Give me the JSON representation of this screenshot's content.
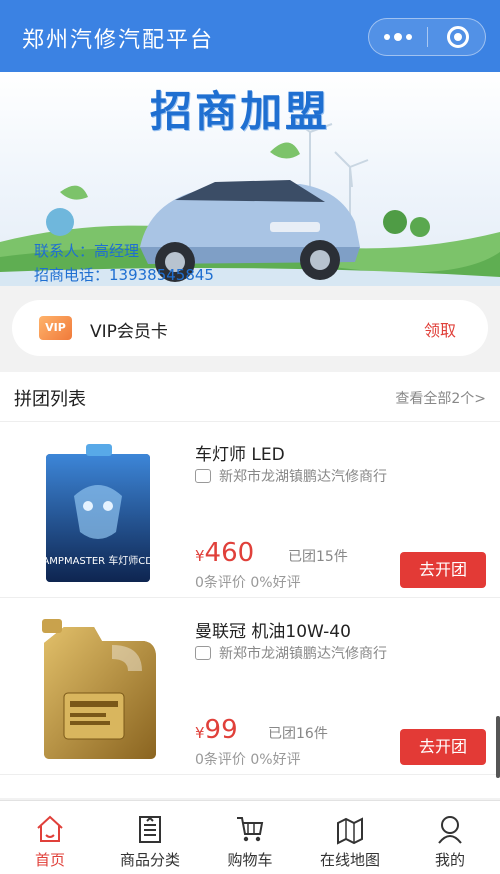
{
  "navbar": {
    "title": "郑州汽修汽配平台"
  },
  "banner": {
    "headline": "招商加盟",
    "contact_person": "联系人：高经理",
    "contact_phone": "招商电话：13938545845"
  },
  "vip_card": {
    "badge": "VIP",
    "label": "VIP会员卡",
    "action": "领取"
  },
  "group_buy": {
    "title": "拼团列表",
    "view_all": "查看全部2个>",
    "items": [
      {
        "name": "车灯师 LED",
        "shop": "新郑市龙湖镇鹏达汽修商行",
        "currency": "¥",
        "price": "460",
        "sold": "已团15件",
        "reviews": "0条评价 0%好评",
        "button": "去开团",
        "box_text": "LAMPMASTER 车灯师CDS"
      },
      {
        "name": "曼联冠 机油10W-40",
        "shop": "新郑市龙湖镇鹏达汽修商行",
        "currency": "¥",
        "price": "99",
        "sold": "已团16件",
        "reviews": "0条评价 0%好评",
        "button": "去开团"
      }
    ]
  },
  "tabbar": {
    "items": [
      {
        "label": "首页",
        "icon": "home-icon",
        "active": true
      },
      {
        "label": "商品分类",
        "icon": "category-icon",
        "active": false
      },
      {
        "label": "购物车",
        "icon": "cart-icon",
        "active": false
      },
      {
        "label": "在线地图",
        "icon": "map-icon",
        "active": false
      },
      {
        "label": "我的",
        "icon": "user-icon",
        "active": false
      }
    ]
  },
  "colors": {
    "nav": "#3b82e3",
    "accent_red": "#e33a36",
    "price_red": "#e0403a"
  }
}
